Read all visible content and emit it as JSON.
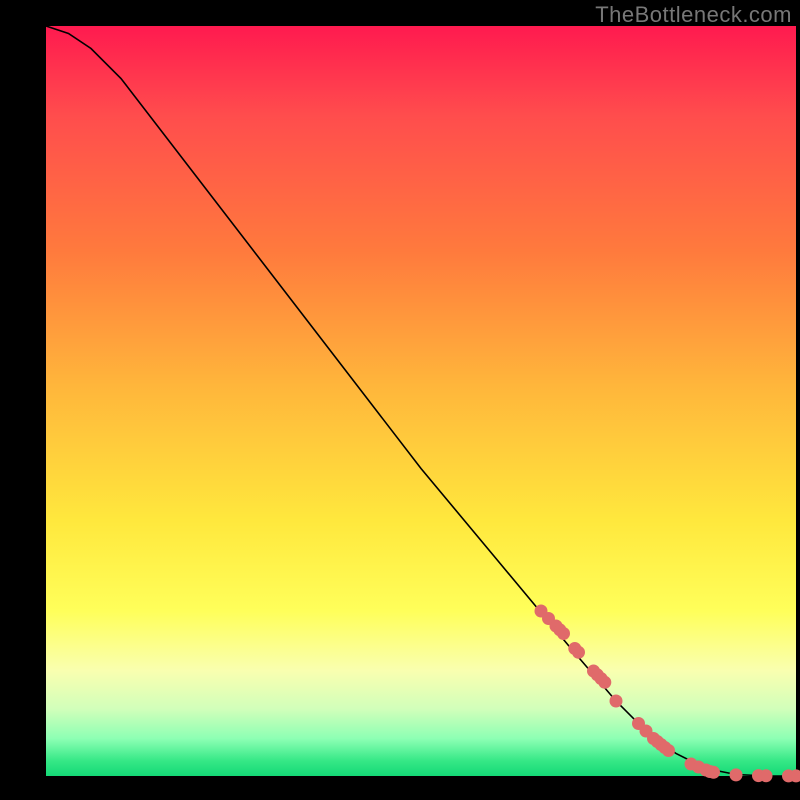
{
  "attribution": "TheBottleneck.com",
  "colors": {
    "background": "#000000",
    "curve": "#000000",
    "dots": "#e06a6a",
    "gradient_top": "#ff1a4f",
    "gradient_bottom": "#14d977"
  },
  "chart_data": {
    "type": "line",
    "title": "",
    "xlabel": "",
    "ylabel": "",
    "xlim": [
      0,
      100
    ],
    "ylim": [
      0,
      100
    ],
    "curve": {
      "x": [
        0,
        3,
        6,
        10,
        20,
        30,
        40,
        50,
        60,
        70,
        76,
        80,
        84,
        88,
        92,
        96,
        100
      ],
      "y": [
        100,
        99,
        97,
        93,
        80,
        67,
        54,
        41,
        29,
        17,
        10,
        6,
        3,
        1,
        0.2,
        0,
        0
      ]
    },
    "series": [
      {
        "name": "highlighted-points",
        "x": [
          66,
          67,
          68,
          68.5,
          69,
          70.5,
          71,
          73,
          73.5,
          74,
          74.5,
          76,
          79,
          80,
          81,
          81.5,
          82,
          82.5,
          83,
          86,
          87,
          88,
          88.5,
          89,
          92,
          95,
          96,
          99,
          100
        ],
        "y": [
          22,
          21,
          20,
          19.5,
          19,
          17,
          16.5,
          14,
          13.5,
          13,
          12.5,
          10,
          7,
          6,
          5,
          4.6,
          4.2,
          3.8,
          3.4,
          1.6,
          1.2,
          0.8,
          0.6,
          0.5,
          0.15,
          0.05,
          0.03,
          0.01,
          0.01
        ]
      }
    ]
  }
}
